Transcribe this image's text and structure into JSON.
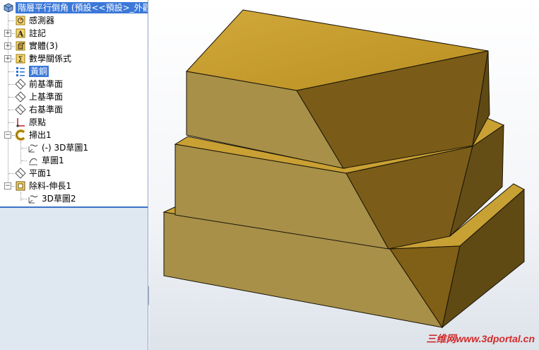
{
  "tree": {
    "root_label": "階層平行倒角 (預設<<預設>_外觀",
    "items": [
      {
        "label": "感測器",
        "icon": "sensor-icon",
        "expandable": false
      },
      {
        "label": "註記",
        "icon": "annotation-icon",
        "expandable": true
      },
      {
        "label": "實體(3)",
        "icon": "solid-bodies-icon",
        "expandable": true
      },
      {
        "label": "數學關係式",
        "icon": "equations-icon",
        "expandable": true
      },
      {
        "label": "黃銅",
        "icon": "material-icon",
        "expandable": false
      },
      {
        "label": "前基準面",
        "icon": "plane-icon",
        "expandable": false
      },
      {
        "label": "上基準面",
        "icon": "plane-icon",
        "expandable": false
      },
      {
        "label": "右基準面",
        "icon": "plane-icon",
        "expandable": false
      },
      {
        "label": "原點",
        "icon": "origin-icon",
        "expandable": false
      },
      {
        "label": "掃出1",
        "icon": "sweep-icon",
        "expandable": true
      },
      {
        "label": "(-) 3D草圖1",
        "icon": "3d-sketch-icon",
        "expandable": false
      },
      {
        "label": "草圖1",
        "icon": "sketch-icon",
        "expandable": false
      },
      {
        "label": "平面1",
        "icon": "plane-icon",
        "expandable": false
      },
      {
        "label": "除料-伸長1",
        "icon": "cut-extrude-icon",
        "expandable": true
      },
      {
        "label": "3D草圖2",
        "icon": "3d-sketch-icon",
        "expandable": false
      }
    ]
  },
  "watermark": "三维网www.3dportal.cn",
  "colors": {
    "selection": "#3b78d8",
    "brass_top": "#c9a032",
    "brass_front": "#a89048",
    "brass_side": "#7e6418"
  }
}
